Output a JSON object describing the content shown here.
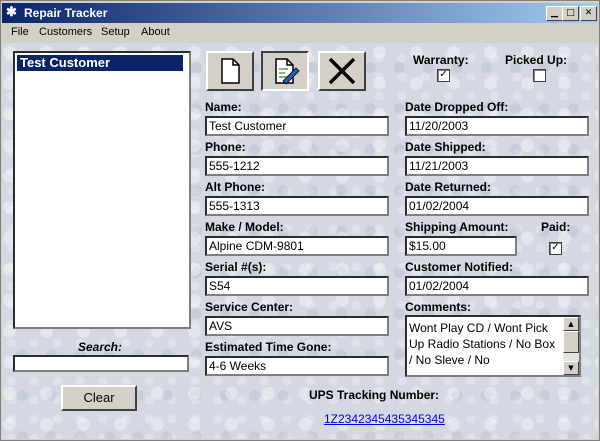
{
  "window": {
    "title": "Repair Tracker"
  },
  "menu": [
    "File",
    "Customers",
    "Setup",
    "About"
  ],
  "customers": {
    "selected": "Test Customer"
  },
  "search": {
    "label": "Search:",
    "value": ""
  },
  "buttons": {
    "clear": "Clear"
  },
  "toolbar": {
    "new_icon": "new-document-icon",
    "edit_icon": "edit-document-icon",
    "delete_icon": "delete-x-icon"
  },
  "flags": {
    "warranty_label": "Warranty:",
    "warranty_checked": "✓",
    "picked_up_label": "Picked Up:",
    "picked_up_checked": "",
    "paid_label": "Paid:",
    "paid_checked": "✓"
  },
  "fields": {
    "name": {
      "label": "Name:",
      "value": "Test Customer"
    },
    "phone": {
      "label": "Phone:",
      "value": "555-1212"
    },
    "alt_phone": {
      "label": "Alt Phone:",
      "value": "555-1313"
    },
    "make_model": {
      "label": "Make / Model:",
      "value": "Alpine CDM-9801"
    },
    "serial": {
      "label": "Serial #(s):",
      "value": "S54"
    },
    "service_center": {
      "label": "Service Center:",
      "value": "AVS"
    },
    "time_gone": {
      "label": "Estimated Time Gone:",
      "value": "4-6 Weeks"
    },
    "date_dropped": {
      "label": "Date Dropped Off:",
      "value": "11/20/2003"
    },
    "date_shipped": {
      "label": "Date Shipped:",
      "value": "11/21/2003"
    },
    "date_returned": {
      "label": "Date Returned:",
      "value": "01/02/2004"
    },
    "shipping_amount": {
      "label": "Shipping Amount:",
      "value": "$15.00"
    },
    "customer_notified": {
      "label": "Customer Notified:",
      "value": "01/02/2004"
    },
    "comments": {
      "label": "Comments:",
      "value": "Wont Play CD / Wont Pick Up Radio Stations / No Box / No Sleve / No"
    }
  },
  "ups": {
    "label": "UPS Tracking Number:",
    "value": "1Z2342345435345345"
  }
}
